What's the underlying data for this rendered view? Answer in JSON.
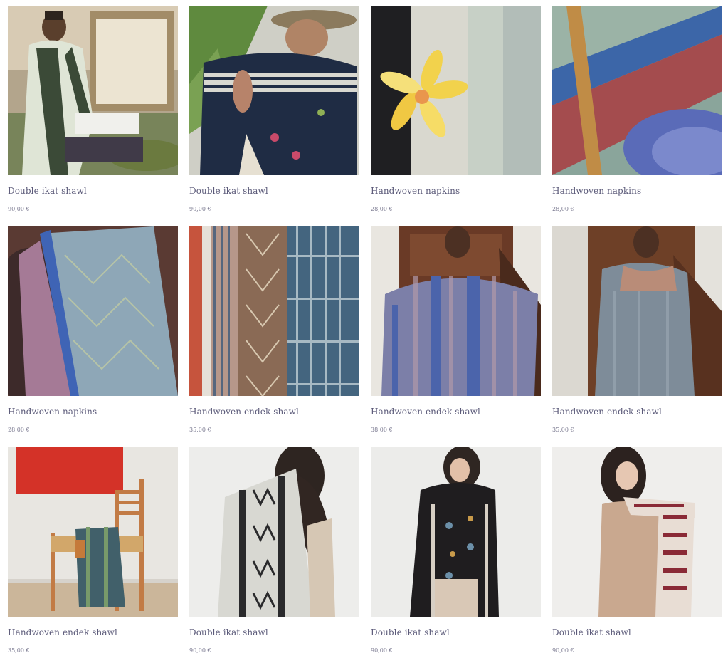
{
  "products": [
    {
      "title": "Double ikat shawl",
      "price": "90,00 €",
      "image": "man-in-ikat-shawl-photo"
    },
    {
      "title": "Double ikat shawl",
      "price": "90,00 €",
      "image": "woman-with-navy-shawl-photo"
    },
    {
      "title": "Handwoven napkins",
      "price": "28,00 €",
      "image": "napkin-with-frangipani-photo"
    },
    {
      "title": "Handwoven napkins",
      "price": "28,00 €",
      "image": "napkin-on-blue-plate-photo"
    },
    {
      "title": "Handwoven napkins",
      "price": "28,00 €",
      "image": "blue-lilac-napkin-photo"
    },
    {
      "title": "Handwoven endek shawl",
      "price": "35,00 €",
      "image": "striped-endek-fabric-photo"
    },
    {
      "title": "Handwoven endek shawl",
      "price": "38,00 €",
      "image": "woman-holding-blue-shawl-photo"
    },
    {
      "title": "Handwoven endek shawl",
      "price": "35,00 €",
      "image": "woman-grey-shawl-photo"
    },
    {
      "title": "Handwoven endek shawl",
      "price": "35,00 €",
      "image": "shawl-on-chair-photo"
    },
    {
      "title": "Double ikat shawl",
      "price": "90,00 €",
      "image": "woman-back-white-shawl-photo"
    },
    {
      "title": "Double ikat shawl",
      "price": "90,00 €",
      "image": "woman-black-ikat-shawl-photo"
    },
    {
      "title": "Double ikat shawl",
      "price": "90,00 €",
      "image": "woman-red-ikat-shawl-photo"
    }
  ]
}
